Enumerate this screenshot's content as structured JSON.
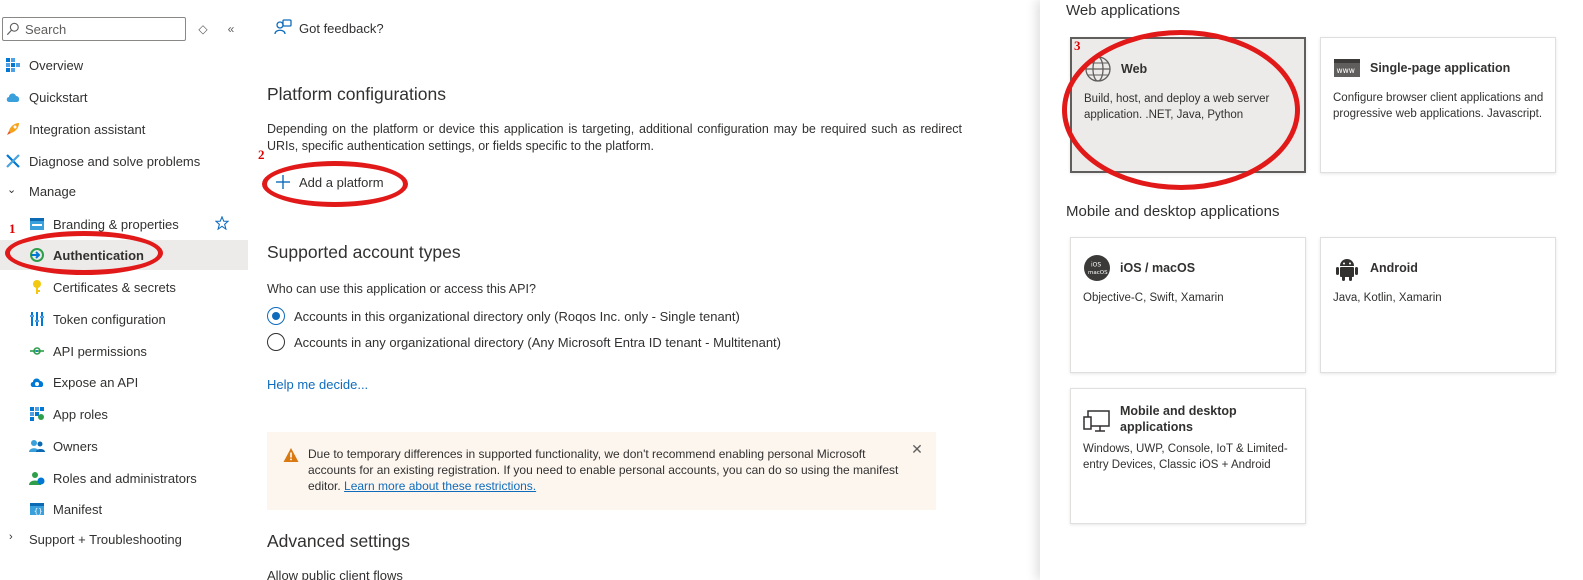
{
  "sidebar": {
    "search_placeholder": "Search",
    "items": [
      {
        "label": "Overview"
      },
      {
        "label": "Quickstart"
      },
      {
        "label": "Integration assistant"
      },
      {
        "label": "Diagnose and solve problems"
      },
      {
        "label": "Manage"
      },
      {
        "label": "Branding & properties"
      },
      {
        "label": "Authentication"
      },
      {
        "label": "Certificates & secrets"
      },
      {
        "label": "Token configuration"
      },
      {
        "label": "API permissions"
      },
      {
        "label": "Expose an API"
      },
      {
        "label": "App roles"
      },
      {
        "label": "Owners"
      },
      {
        "label": "Roles and administrators"
      },
      {
        "label": "Manifest"
      },
      {
        "label": "Support + Troubleshooting"
      }
    ]
  },
  "annotations": {
    "mark1": "1",
    "mark2": "2",
    "mark3": "3"
  },
  "main": {
    "feedback_label": "Got feedback?",
    "platform_title": "Platform configurations",
    "platform_desc": "Depending on the platform or device this application is targeting, additional configuration may be required such as redirect URIs, specific authentication settings, or fields specific to the platform.",
    "add_platform_label": "Add a platform",
    "account_types_title": "Supported account types",
    "account_question": "Who can use this application or access this API?",
    "radio_options": [
      {
        "label": "Accounts in this organizational directory only (Roqos Inc. only - Single tenant)",
        "selected": true
      },
      {
        "label": "Accounts in any organizational directory (Any Microsoft Entra ID tenant - Multitenant)",
        "selected": false
      }
    ],
    "help_link": "Help me decide...",
    "banner_text": "Due to temporary differences in supported functionality, we don't recommend enabling personal Microsoft accounts for an existing registration. If you need to enable personal accounts, you can do so using the manifest editor. ",
    "banner_link": "Learn more about these restrictions.",
    "advanced_title": "Advanced settings",
    "cut_text": "Allow public client flows"
  },
  "panel": {
    "web_section": "Web applications",
    "mobile_section": "Mobile and desktop applications",
    "cards": [
      {
        "title": "Web",
        "desc": "Build, host, and deploy a web server application. .NET, Java, Python",
        "icon": "globe-icon"
      },
      {
        "title": "Single-page application",
        "desc": "Configure browser client applications and progressive web applications. Javascript.",
        "icon": "www-icon"
      },
      {
        "title": "iOS / macOS",
        "desc": "Objective-C, Swift, Xamarin",
        "icon": "ios-icon"
      },
      {
        "title": "Android",
        "desc": "Java, Kotlin, Xamarin",
        "icon": "android-icon"
      },
      {
        "title": "Mobile and desktop applications",
        "desc": "Windows, UWP, Console, IoT & Limited-entry Devices, Classic iOS + Android",
        "icon": "desktop-icon"
      }
    ]
  },
  "colors": {
    "accent": "#0f6cbd",
    "annotation": "#e11919",
    "selected_bg": "#edebe9",
    "banner_bg": "#fdf6ef"
  }
}
